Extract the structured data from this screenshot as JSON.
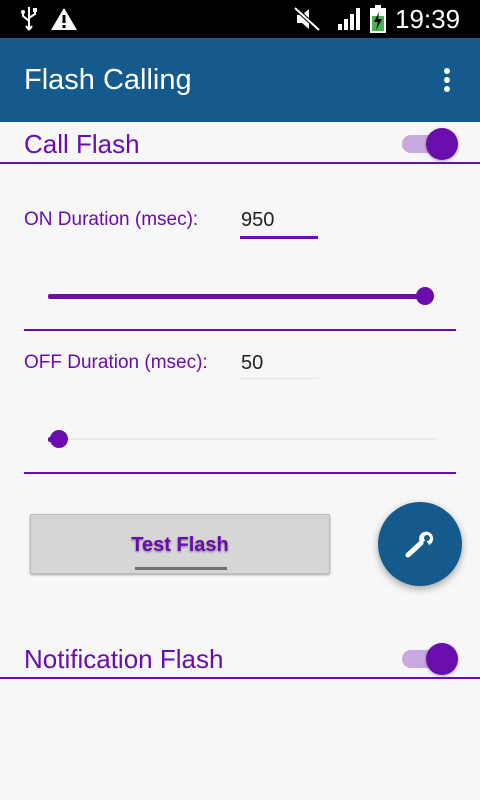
{
  "status_bar": {
    "time": "19:39",
    "icons": [
      "usb-icon",
      "warning-icon",
      "mute-icon",
      "signal-icon",
      "battery-charging-icon"
    ]
  },
  "app_bar": {
    "title": "Flash Calling",
    "menu_icon": "overflow-menu-icon"
  },
  "call_flash": {
    "title": "Call Flash",
    "enabled": true,
    "on_duration": {
      "label": "ON Duration (msec):",
      "value": "950",
      "slider_fraction": 1.0
    },
    "off_duration": {
      "label": "OFF Duration (msec):",
      "value": "50",
      "slider_fraction": 0.0
    },
    "test_button_label": "Test Flash",
    "fab_icon": "wrench-icon"
  },
  "notification_flash": {
    "title": "Notification Flash",
    "enabled": true
  },
  "colors": {
    "accent": "#6a0dad",
    "app_bar": "#145a8c",
    "switch_track": "#c9a9e0"
  }
}
